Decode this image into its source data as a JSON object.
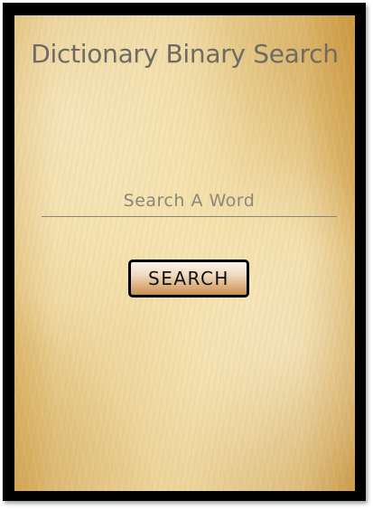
{
  "app": {
    "title": "Dictionary Binary Search"
  },
  "search": {
    "value": "",
    "placeholder": "Search A Word",
    "button_label": "SEARCH"
  }
}
